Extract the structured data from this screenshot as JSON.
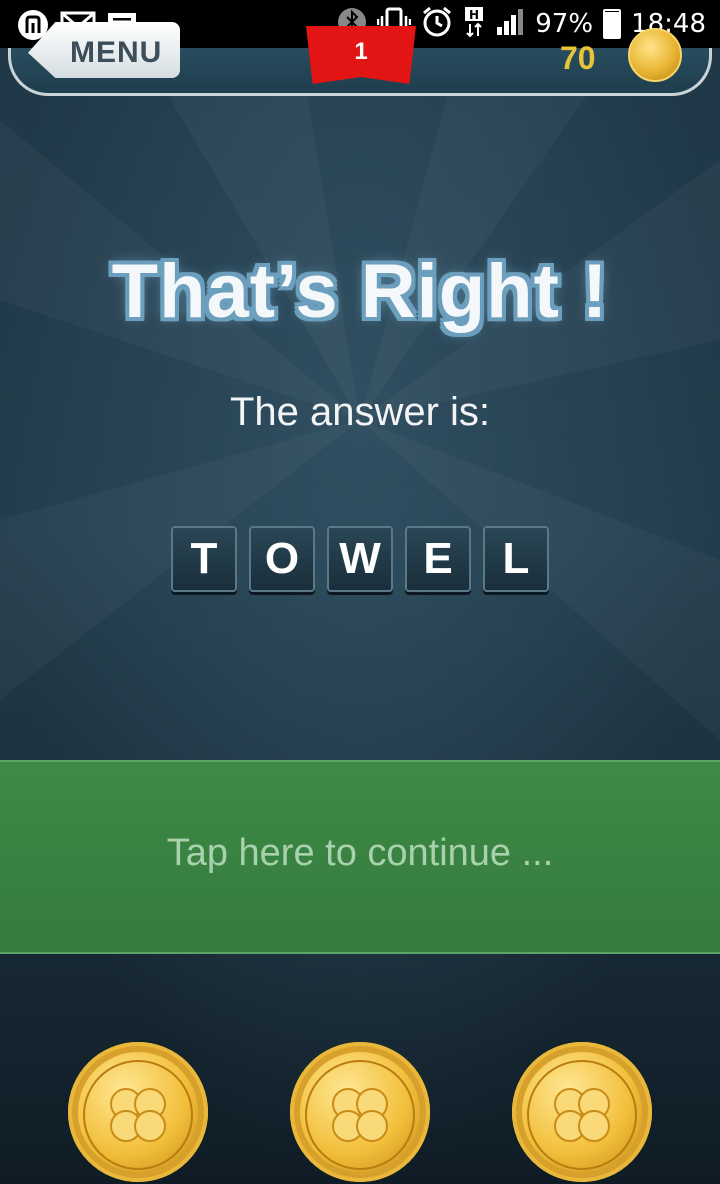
{
  "status_bar": {
    "battery_percent": "97%",
    "battery_level": 0.97,
    "time": "18:48",
    "icons_left": [
      "app-notification-icon",
      "gmail-icon",
      "message-icon"
    ],
    "icons_right": [
      "bluetooth-icon",
      "vibrate-icon",
      "alarm-icon",
      "hspa-data-icon",
      "signal-icon",
      "battery-icon"
    ]
  },
  "topbar": {
    "menu_label": "MENU",
    "level": "1",
    "coins": "70"
  },
  "result": {
    "headline": "That’s Right !",
    "answer_label": "The answer is:",
    "answer_letters": [
      "T",
      "O",
      "W",
      "E",
      "L"
    ]
  },
  "continue": {
    "label": "Tap here to continue ..."
  },
  "colors": {
    "background": "#1e3442",
    "continue_band": "#3e8a46",
    "level_flag": "#e31414",
    "coin_gold": "#f2bf3b",
    "coin_text": "#e8c43a"
  }
}
